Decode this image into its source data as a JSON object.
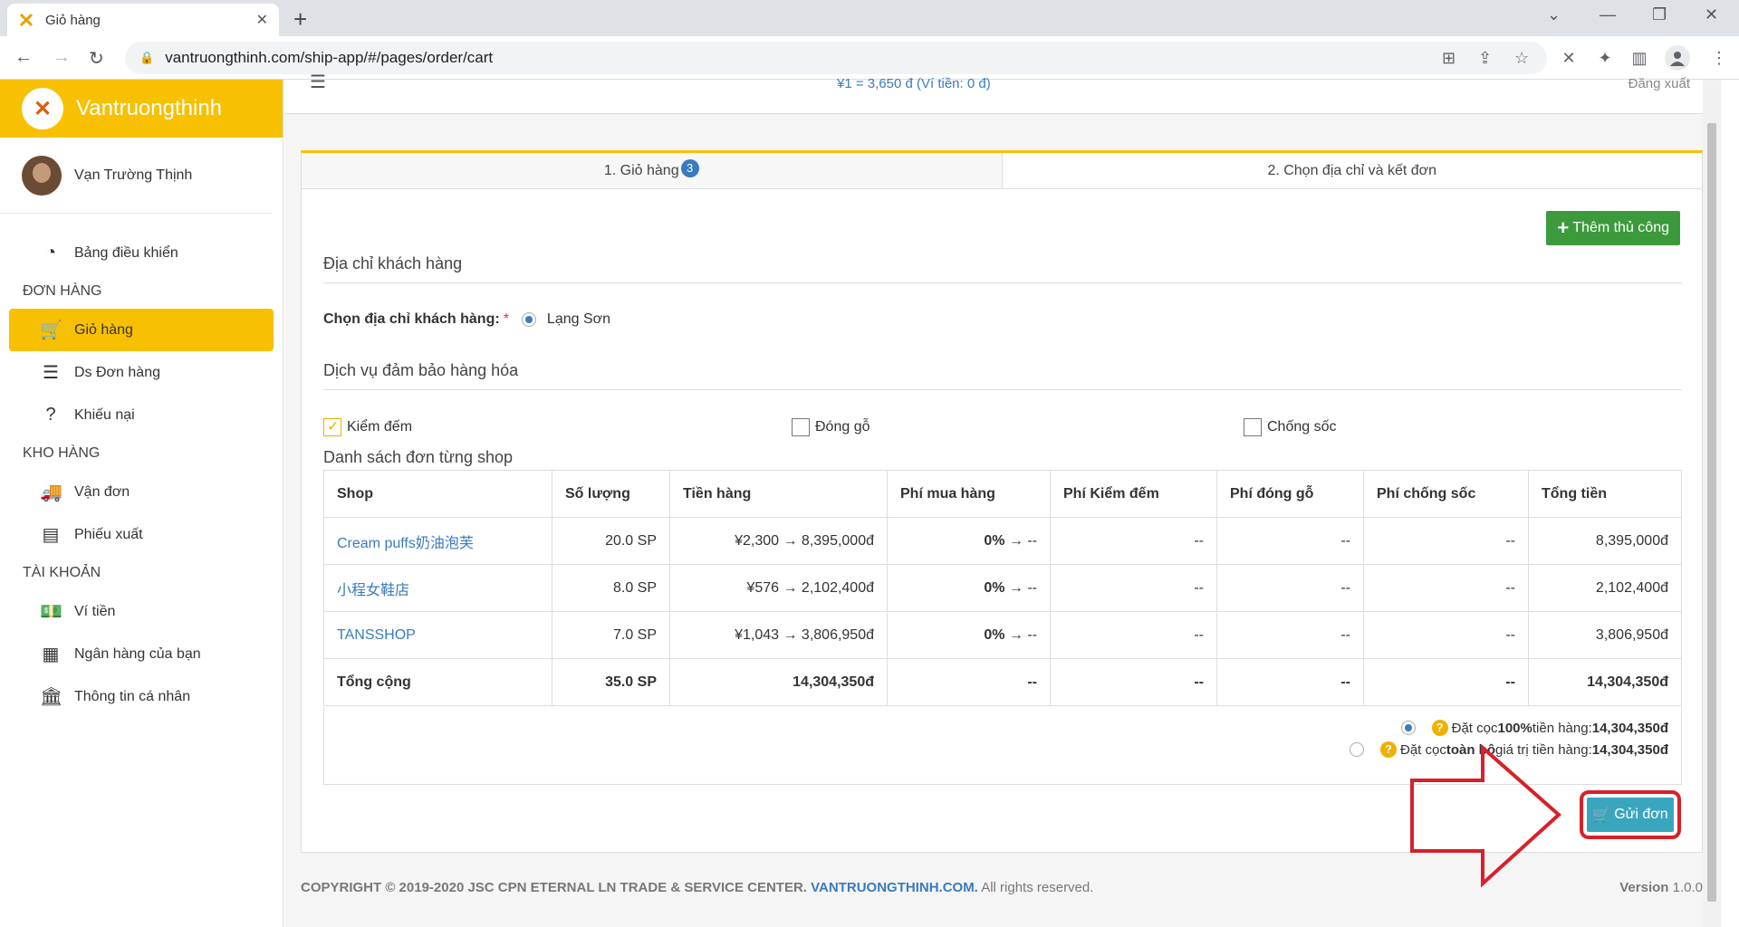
{
  "browser": {
    "tab_title": "Giỏ hàng",
    "url": "vantruongthinh.com/ship-app/#/pages/order/cart"
  },
  "app": {
    "brand": "Vantruongthinh",
    "user_name": "Vạn Trường Thịnh",
    "rate_text": "¥1 = 3,650 đ (Ví tiền: 0 đ)",
    "logout": "Đăng xuất"
  },
  "sidebar": {
    "items": [
      {
        "label": "Bảng điều khiển",
        "icon": "dashboard-icon"
      },
      {
        "section": "ĐƠN HÀNG"
      },
      {
        "label": "Giỏ hàng",
        "icon": "cart-icon",
        "active": true
      },
      {
        "label": "Ds Đơn hàng",
        "icon": "list-icon"
      },
      {
        "label": "Khiếu nại",
        "icon": "question-icon"
      },
      {
        "section": "KHO HÀNG"
      },
      {
        "label": "Vận đơn",
        "icon": "truck-icon"
      },
      {
        "label": "Phiếu xuất",
        "icon": "receipt-icon"
      },
      {
        "section": "TÀI KHOẢN"
      },
      {
        "label": "Ví tiền",
        "icon": "money-icon"
      },
      {
        "label": "Ngân hàng của bạn",
        "icon": "calendar-icon"
      },
      {
        "label": "Thông tin cá nhân",
        "icon": "bank-icon"
      }
    ]
  },
  "steps": {
    "step1": "1. Giỏ hàng",
    "step1_badge": "3",
    "step2": "2. Chọn địa chỉ và kết đơn"
  },
  "add_button": "Thêm thủ công",
  "address": {
    "heading": "Địa chỉ khách hàng",
    "label": "Chọn địa chỉ khách hàng:",
    "required": "*",
    "option": "Lạng Sơn"
  },
  "services": {
    "heading": "Dịch vụ đảm bảo hàng hóa",
    "options": [
      {
        "label": "Kiểm đếm",
        "checked": true
      },
      {
        "label": "Đóng gỗ",
        "checked": false
      },
      {
        "label": "Chống sốc",
        "checked": false
      }
    ]
  },
  "shop_list": {
    "heading": "Danh sách đơn từng shop",
    "columns": [
      "Shop",
      "Số lượng",
      "Tiền hàng",
      "Phí mua hàng",
      "Phí Kiểm đếm",
      "Phí đóng gỗ",
      "Phí chống sốc",
      "Tổng tiền"
    ],
    "rows": [
      {
        "shop": "Cream puffs奶油泡芙",
        "qty": "20.0 SP",
        "goods": "¥2,300 → 8,395,000đ",
        "fee_pct": "0%",
        "fee_rest": " → --",
        "check": "--",
        "wood": "--",
        "shock": "--",
        "total": "8,395,000đ"
      },
      {
        "shop": "小程女鞋店",
        "qty": "8.0 SP",
        "goods": "¥576 → 2,102,400đ",
        "fee_pct": "0%",
        "fee_rest": " → --",
        "check": "--",
        "wood": "--",
        "shock": "--",
        "total": "2,102,400đ"
      },
      {
        "shop": "TANSSHOP",
        "qty": "7.0 SP",
        "goods": "¥1,043 → 3,806,950đ",
        "fee_pct": "0%",
        "fee_rest": " → --",
        "check": "--",
        "wood": "--",
        "shock": "--",
        "total": "3,806,950đ"
      }
    ],
    "total_row": {
      "label": "Tổng cộng",
      "qty": "35.0 SP",
      "goods": "14,304,350đ",
      "fee": "--",
      "check": "--",
      "wood": "--",
      "shock": "--",
      "total": "14,304,350đ"
    }
  },
  "deposit": {
    "opt1_prefix": "Đặt cọc ",
    "opt1_bold": "100%",
    "opt1_mid": " tiền hàng: ",
    "opt1_amount": "14,304,350đ",
    "opt2_prefix": "Đặt cọc ",
    "opt2_bold": "toàn bộ",
    "opt2_mid": " giá trị tiền hàng: ",
    "opt2_amount": "14,304,350đ"
  },
  "send_button": "Gửi đơn",
  "footer": {
    "copyright": "COPYRIGHT © 2019-2020 JSC CPN ETERNAL LN TRADE & SERVICE CENTER.",
    "site": "VANTRUONGTHINH.COM.",
    "rights": " All rights reserved.",
    "version_label": "Version",
    "version": "1.0.0"
  },
  "colors": {
    "brand": "#f7c000",
    "link": "#3a7abf",
    "add": "#3c9a3c",
    "send": "#3aa6be",
    "highlight": "#d8202a"
  }
}
